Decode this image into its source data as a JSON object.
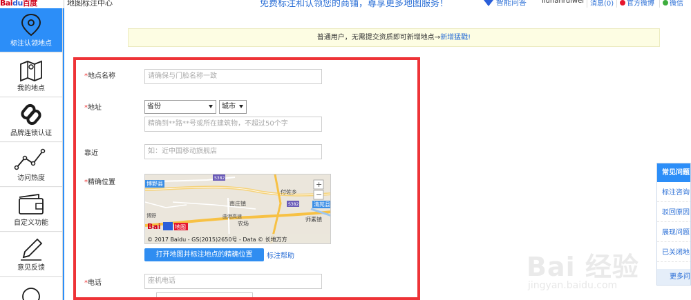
{
  "header": {
    "logo_text": "Bai",
    "logo_paw": "du",
    "logo_suffix": "百度",
    "site_title": "地图标注中心",
    "slogan": "免费标注和认领您的商铺，尊享更多地图服务！",
    "qa_label": "智能问答",
    "username": "liuhanruiwei",
    "messages": "消息(0)",
    "weibo": "官方微博",
    "wechat": "微信"
  },
  "sidebar": {
    "items": [
      {
        "label": "标注认领地点",
        "icon": "location-pin-icon",
        "active": true
      },
      {
        "label": "我的地点",
        "icon": "map-icon",
        "active": false
      },
      {
        "label": "品牌连锁认证",
        "icon": "chain-link-icon",
        "active": false
      },
      {
        "label": "访问热度",
        "icon": "line-chart-icon",
        "active": false
      },
      {
        "label": "自定义功能",
        "icon": "wallet-icon",
        "active": false
      },
      {
        "label": "意见反馈",
        "icon": "pencil-icon",
        "active": false
      }
    ]
  },
  "notice": {
    "text": "普通用户，无需提交资质即可新增地点→",
    "link": "新增猛戳!"
  },
  "form": {
    "name_label": "地点名称",
    "name_placeholder": "请确保与门脸名称一致",
    "address_label": "地址",
    "province_value": "省份",
    "city_value": "城市",
    "address_placeholder": "精确到**路**号或所在建筑物，不超过50个字",
    "nearby_label": "靠近",
    "nearby_placeholder": "如：近中国移动旗舰店",
    "location_label": "精确位置",
    "map_button": "打开地图并标注地点的精确位置",
    "map_help": "标注帮助",
    "phone_label": "电话",
    "phone_placeholder": "座机电话"
  },
  "map": {
    "labels": [
      "博野县",
      "S382",
      "付佐乡",
      "S382",
      "南庄镇",
      "曲港高速",
      "农场",
      "师素镇",
      "清苑县",
      "博野"
    ],
    "copyright": "© 2017 Baidu - GS(2015)2650号 - Data © 长地万方",
    "zoom_in": "+",
    "zoom_out": "−",
    "logo": "Bai",
    "logo2": "地图"
  },
  "help_panel": {
    "title": "常见问题",
    "items": [
      "标注咨询",
      "驳回原因",
      "展现问题",
      "已关闭地"
    ],
    "more": "更多问"
  },
  "watermark": {
    "text": "Bai 经验",
    "url": "jingyan.baidu.com"
  },
  "colors": {
    "accent": "#2c8ef8",
    "highlight_border": "#ee3337",
    "notice_bg": "#fdfde3",
    "required": "#e33333"
  }
}
